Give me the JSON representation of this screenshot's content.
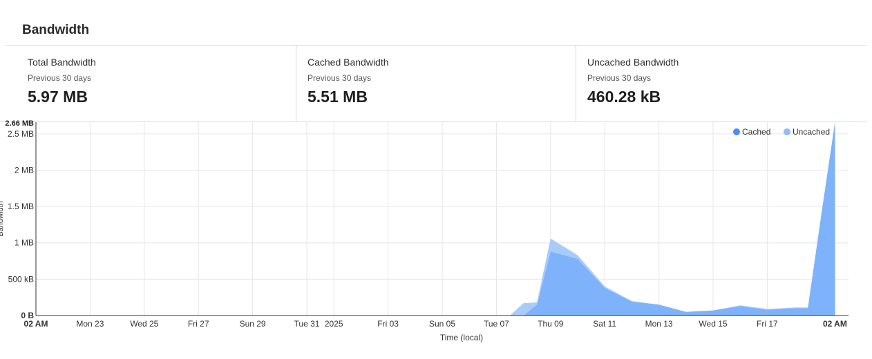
{
  "header": {
    "title": "Bandwidth"
  },
  "stats": [
    {
      "label": "Total Bandwidth",
      "period": "Previous 30 days",
      "value": "5.97 MB"
    },
    {
      "label": "Cached Bandwidth",
      "period": "Previous 30 days",
      "value": "5.51 MB"
    },
    {
      "label": "Uncached Bandwidth",
      "period": "Previous 30 days",
      "value": "460.28 kB"
    }
  ],
  "chart_data": {
    "type": "area",
    "stacked": true,
    "title": "",
    "xlabel": "Time (local)",
    "ylabel": "Bandwidth",
    "y_unit": "MB",
    "ylim": [
      0,
      2.66
    ],
    "xlim": [
      0,
      30
    ],
    "grid": true,
    "legend_position": "top-right",
    "x_tick_positions": [
      0,
      2,
      4,
      6,
      8,
      10,
      11,
      13,
      15,
      17,
      19,
      21,
      23,
      25,
      27,
      29.5
    ],
    "x_tick_labels": [
      "02 AM",
      "Mon 23",
      "Wed 25",
      "Fri 27",
      "Sun 29",
      "Tue 31",
      "2025",
      "Fri 03",
      "Sun 05",
      "Tue 07",
      "Thu 09",
      "Sat 11",
      "Mon 13",
      "Wed 15",
      "Fri 17",
      "02 AM"
    ],
    "y_ticks": [
      0,
      0.5,
      1,
      1.5,
      2,
      2.5
    ],
    "y_tick_labels": [
      "0 B",
      "500 kB",
      "1 MB",
      "1.5 MB",
      "2 MB",
      "2.5 MB"
    ],
    "y_max_label": "2.66 MB",
    "x": [
      0,
      17.5,
      18,
      18.5,
      19,
      20,
      21,
      22,
      23,
      24,
      25,
      26,
      27,
      28,
      28.5,
      29,
      29.5
    ],
    "series": [
      {
        "name": "Cached",
        "color": "#7eb2fb",
        "values": [
          0,
          0,
          0,
          0.15,
          0.88,
          0.78,
          0.38,
          0.19,
          0.15,
          0.05,
          0.07,
          0.13,
          0.08,
          0.1,
          0.1,
          1.4,
          2.66
        ]
      },
      {
        "name": "Uncached",
        "color": "#a9cbfa",
        "values": [
          0,
          0,
          0.17,
          0.03,
          0.18,
          0.05,
          0.02,
          0.01,
          0.0,
          0.0,
          0.0,
          0.01,
          0.01,
          0.01,
          0.01,
          0.0,
          0.0
        ]
      }
    ]
  }
}
